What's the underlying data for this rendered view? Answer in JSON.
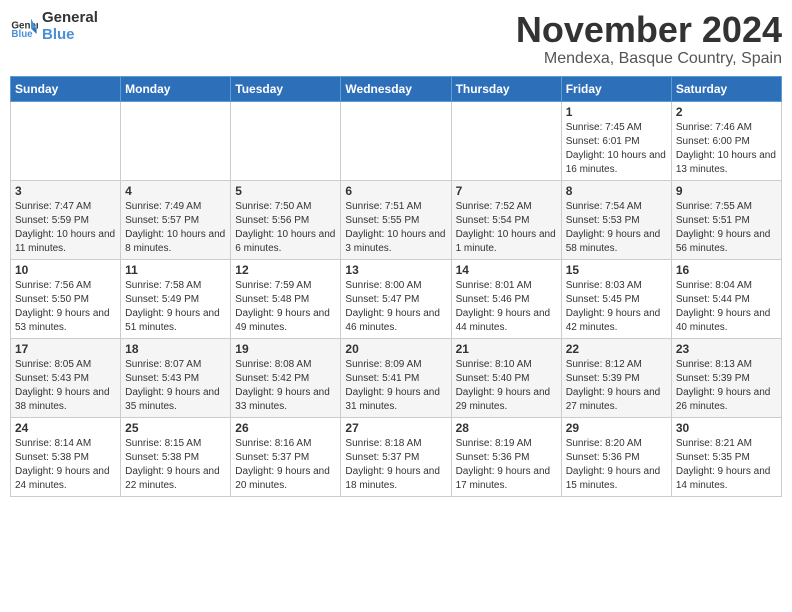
{
  "header": {
    "logo_general": "General",
    "logo_blue": "Blue",
    "month_title": "November 2024",
    "location": "Mendexa, Basque Country, Spain"
  },
  "weekdays": [
    "Sunday",
    "Monday",
    "Tuesday",
    "Wednesday",
    "Thursday",
    "Friday",
    "Saturday"
  ],
  "weeks": [
    [
      {
        "day": "",
        "info": ""
      },
      {
        "day": "",
        "info": ""
      },
      {
        "day": "",
        "info": ""
      },
      {
        "day": "",
        "info": ""
      },
      {
        "day": "",
        "info": ""
      },
      {
        "day": "1",
        "info": "Sunrise: 7:45 AM\nSunset: 6:01 PM\nDaylight: 10 hours and 16 minutes."
      },
      {
        "day": "2",
        "info": "Sunrise: 7:46 AM\nSunset: 6:00 PM\nDaylight: 10 hours and 13 minutes."
      }
    ],
    [
      {
        "day": "3",
        "info": "Sunrise: 7:47 AM\nSunset: 5:59 PM\nDaylight: 10 hours and 11 minutes."
      },
      {
        "day": "4",
        "info": "Sunrise: 7:49 AM\nSunset: 5:57 PM\nDaylight: 10 hours and 8 minutes."
      },
      {
        "day": "5",
        "info": "Sunrise: 7:50 AM\nSunset: 5:56 PM\nDaylight: 10 hours and 6 minutes."
      },
      {
        "day": "6",
        "info": "Sunrise: 7:51 AM\nSunset: 5:55 PM\nDaylight: 10 hours and 3 minutes."
      },
      {
        "day": "7",
        "info": "Sunrise: 7:52 AM\nSunset: 5:54 PM\nDaylight: 10 hours and 1 minute."
      },
      {
        "day": "8",
        "info": "Sunrise: 7:54 AM\nSunset: 5:53 PM\nDaylight: 9 hours and 58 minutes."
      },
      {
        "day": "9",
        "info": "Sunrise: 7:55 AM\nSunset: 5:51 PM\nDaylight: 9 hours and 56 minutes."
      }
    ],
    [
      {
        "day": "10",
        "info": "Sunrise: 7:56 AM\nSunset: 5:50 PM\nDaylight: 9 hours and 53 minutes."
      },
      {
        "day": "11",
        "info": "Sunrise: 7:58 AM\nSunset: 5:49 PM\nDaylight: 9 hours and 51 minutes."
      },
      {
        "day": "12",
        "info": "Sunrise: 7:59 AM\nSunset: 5:48 PM\nDaylight: 9 hours and 49 minutes."
      },
      {
        "day": "13",
        "info": "Sunrise: 8:00 AM\nSunset: 5:47 PM\nDaylight: 9 hours and 46 minutes."
      },
      {
        "day": "14",
        "info": "Sunrise: 8:01 AM\nSunset: 5:46 PM\nDaylight: 9 hours and 44 minutes."
      },
      {
        "day": "15",
        "info": "Sunrise: 8:03 AM\nSunset: 5:45 PM\nDaylight: 9 hours and 42 minutes."
      },
      {
        "day": "16",
        "info": "Sunrise: 8:04 AM\nSunset: 5:44 PM\nDaylight: 9 hours and 40 minutes."
      }
    ],
    [
      {
        "day": "17",
        "info": "Sunrise: 8:05 AM\nSunset: 5:43 PM\nDaylight: 9 hours and 38 minutes."
      },
      {
        "day": "18",
        "info": "Sunrise: 8:07 AM\nSunset: 5:43 PM\nDaylight: 9 hours and 35 minutes."
      },
      {
        "day": "19",
        "info": "Sunrise: 8:08 AM\nSunset: 5:42 PM\nDaylight: 9 hours and 33 minutes."
      },
      {
        "day": "20",
        "info": "Sunrise: 8:09 AM\nSunset: 5:41 PM\nDaylight: 9 hours and 31 minutes."
      },
      {
        "day": "21",
        "info": "Sunrise: 8:10 AM\nSunset: 5:40 PM\nDaylight: 9 hours and 29 minutes."
      },
      {
        "day": "22",
        "info": "Sunrise: 8:12 AM\nSunset: 5:39 PM\nDaylight: 9 hours and 27 minutes."
      },
      {
        "day": "23",
        "info": "Sunrise: 8:13 AM\nSunset: 5:39 PM\nDaylight: 9 hours and 26 minutes."
      }
    ],
    [
      {
        "day": "24",
        "info": "Sunrise: 8:14 AM\nSunset: 5:38 PM\nDaylight: 9 hours and 24 minutes."
      },
      {
        "day": "25",
        "info": "Sunrise: 8:15 AM\nSunset: 5:38 PM\nDaylight: 9 hours and 22 minutes."
      },
      {
        "day": "26",
        "info": "Sunrise: 8:16 AM\nSunset: 5:37 PM\nDaylight: 9 hours and 20 minutes."
      },
      {
        "day": "27",
        "info": "Sunrise: 8:18 AM\nSunset: 5:37 PM\nDaylight: 9 hours and 18 minutes."
      },
      {
        "day": "28",
        "info": "Sunrise: 8:19 AM\nSunset: 5:36 PM\nDaylight: 9 hours and 17 minutes."
      },
      {
        "day": "29",
        "info": "Sunrise: 8:20 AM\nSunset: 5:36 PM\nDaylight: 9 hours and 15 minutes."
      },
      {
        "day": "30",
        "info": "Sunrise: 8:21 AM\nSunset: 5:35 PM\nDaylight: 9 hours and 14 minutes."
      }
    ]
  ]
}
